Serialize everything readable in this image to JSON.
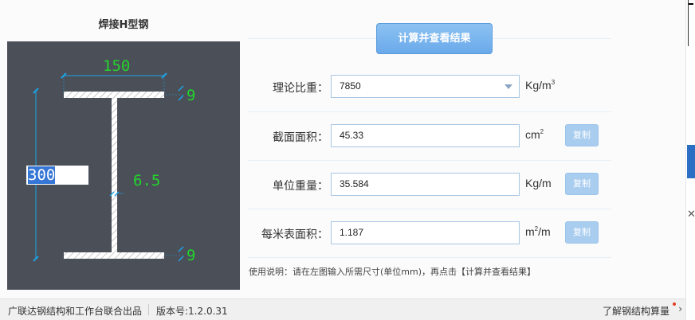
{
  "left_panel": {
    "title": "焊接H型钢",
    "dims": {
      "width": "150",
      "top_flange": "9",
      "bottom_flange": "9",
      "web": "6.5",
      "height": "300"
    }
  },
  "actions": {
    "calculate_label": "计算并查看结果",
    "copy_label": "复制"
  },
  "rows": {
    "density": {
      "label": "理论比重：",
      "value": "7850",
      "unit_base": "Kg/m",
      "unit_sup": "3"
    },
    "area": {
      "label": "截面面积：",
      "value": "45.33",
      "unit_base": "cm",
      "unit_sup": "2"
    },
    "weight": {
      "label": "单位重量：",
      "value": "35.584",
      "unit_base": "Kg/m"
    },
    "surface": {
      "label": "每米表面积：",
      "value": "1.187",
      "unit_base": "m",
      "unit_sup": "2",
      "unit_tail": "/m"
    }
  },
  "instructions": "使用说明：请在左图输入所需尺寸(单位mm)，再点击【计算并查看结果】",
  "status_bar": {
    "left": "广联达钢结构和工作台联合出品",
    "version": "版本号:1.2.0.31",
    "right": "了解钢结构算量"
  },
  "colors": {
    "drawing_bg": "#4b4f58",
    "dimension_text": "#22d42c",
    "dimension_marks": "#1da3e6",
    "button_blue": "#7bb6ef"
  }
}
